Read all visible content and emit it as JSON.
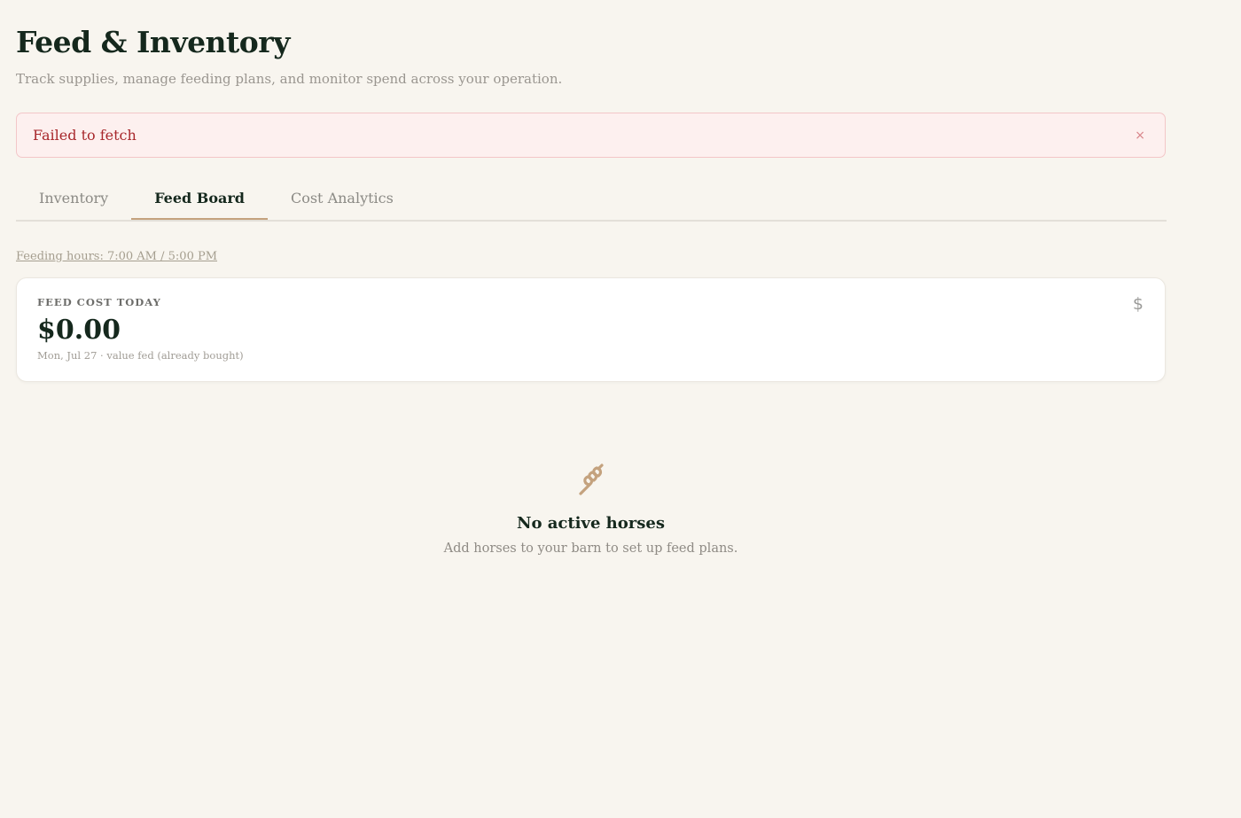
{
  "header": {
    "title": "Feed & Inventory",
    "subtitle": "Track supplies, manage feeding plans, and monitor spend across your operation."
  },
  "error": {
    "message": "Failed to fetch",
    "close_glyph": "×"
  },
  "tabs": [
    {
      "label": "Inventory",
      "active": false
    },
    {
      "label": "Feed Board",
      "active": true
    },
    {
      "label": "Cost Analytics",
      "active": false
    }
  ],
  "feeding_hours": "Feeding hours: 7:00 AM / 5:00 PM",
  "cost_card": {
    "label": "FEED COST TODAY",
    "value": "$0.00",
    "note": "Mon, Jul 27 · value fed (already bought)",
    "icon": "dollar-icon",
    "icon_glyph": "$"
  },
  "empty_state": {
    "icon": "wheat-icon",
    "title": "No active horses",
    "description": "Add horses to your barn to set up feed plans."
  },
  "colors": {
    "background": "#f8f5ef",
    "accent": "#c4a27e",
    "error_text": "#a8282c",
    "error_bg": "#fdf0ef",
    "heading": "#15281d"
  }
}
